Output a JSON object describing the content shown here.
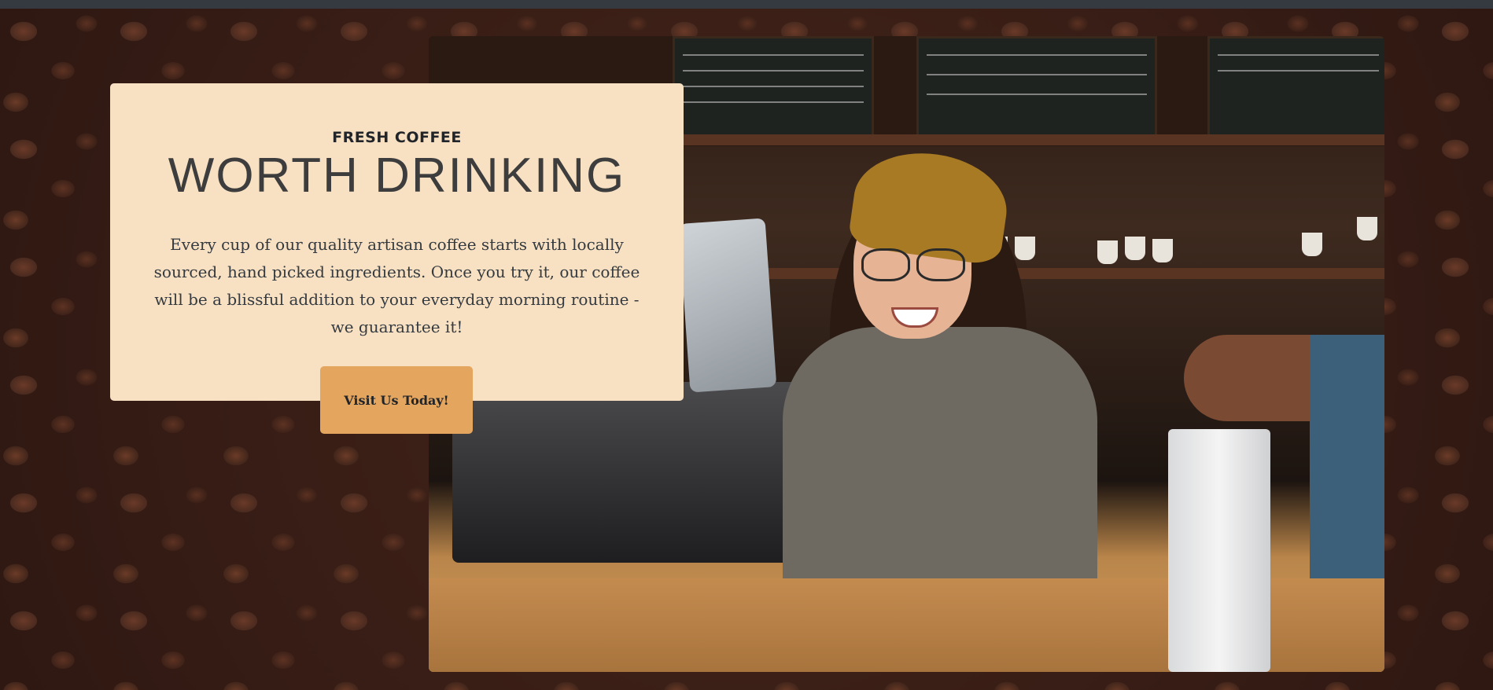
{
  "card": {
    "eyebrow": "FRESH COFFEE",
    "headline": "WORTH DRINKING",
    "body": "Every cup of our quality artisan coffee starts with locally sourced, hand picked ingredients. Once you try it, our coffee will be a blissful addition to your everyday morning routine - we guarantee it!",
    "cta_label": "Visit Us Today!"
  },
  "colors": {
    "card_bg": "#f8e1c2",
    "cta_bg": "#e4a55e",
    "topbar": "#343a40"
  },
  "icons": {
    "background": "coffee-beans-background",
    "photo": "barista-photo"
  }
}
